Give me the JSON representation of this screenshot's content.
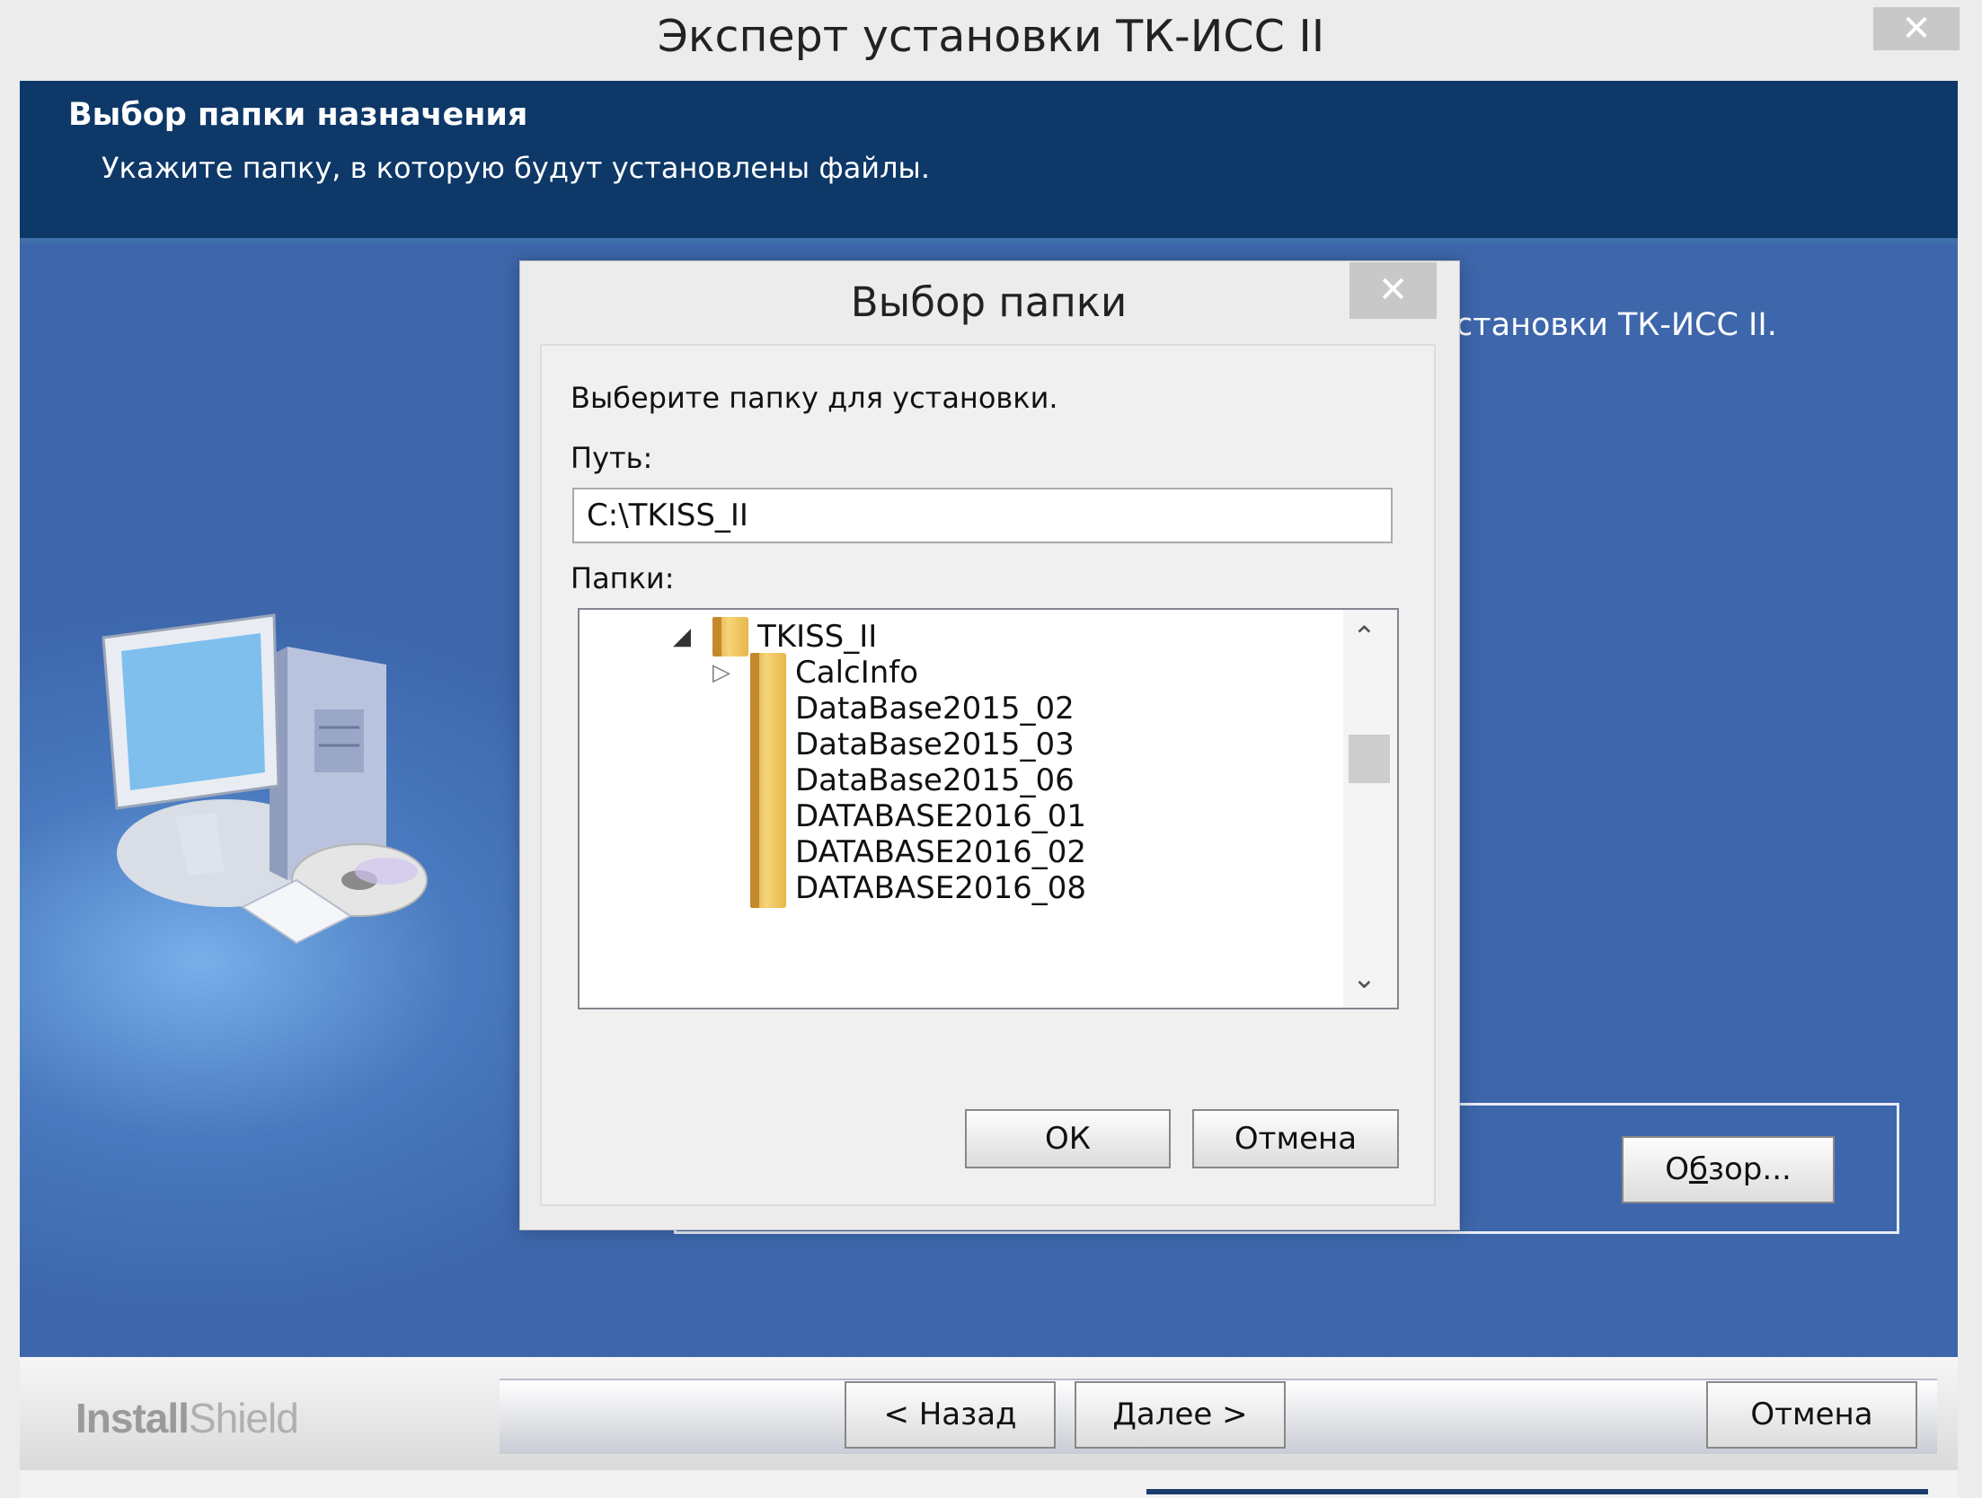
{
  "window": {
    "title": "Эксперт установки ТК-ИСС II",
    "close_icon": "close-icon"
  },
  "header": {
    "title": "Выбор папки назначения",
    "subtitle": "Укажите папку, в которую будут установлены файлы."
  },
  "content": {
    "partial_text": "становки ТК-ИСС II.",
    "browse_label": "Обзор..."
  },
  "dialog": {
    "title": "Выбор папки",
    "prompt": "Выберите папку для установки.",
    "path_label": "Путь:",
    "path_value": "C:\\TKISS_II",
    "folders_label": "Папки:",
    "tree": [
      {
        "label": "TKISS_II",
        "expander": "expanded"
      },
      {
        "label": "CalcInfo",
        "expander": "collapsed"
      },
      {
        "label": "DataBase2015_02",
        "expander": "none"
      },
      {
        "label": "DataBase2015_03",
        "expander": "none"
      },
      {
        "label": "DataBase2015_06",
        "expander": "none"
      },
      {
        "label": "DATABASE2016_01",
        "expander": "none"
      },
      {
        "label": "DATABASE2016_02",
        "expander": "none"
      },
      {
        "label": "DATABASE2016_08",
        "expander": "none"
      }
    ],
    "ok_label": "ОК",
    "cancel_label": "Отмена"
  },
  "footer": {
    "brand_bold": "Install",
    "brand_light": "Shield",
    "back_label": "< Назад",
    "next_label": "Далее >",
    "cancel_label": "Отмена"
  },
  "colors": {
    "header_bg": "#0d3868",
    "content_bg": "#3d66ab"
  }
}
